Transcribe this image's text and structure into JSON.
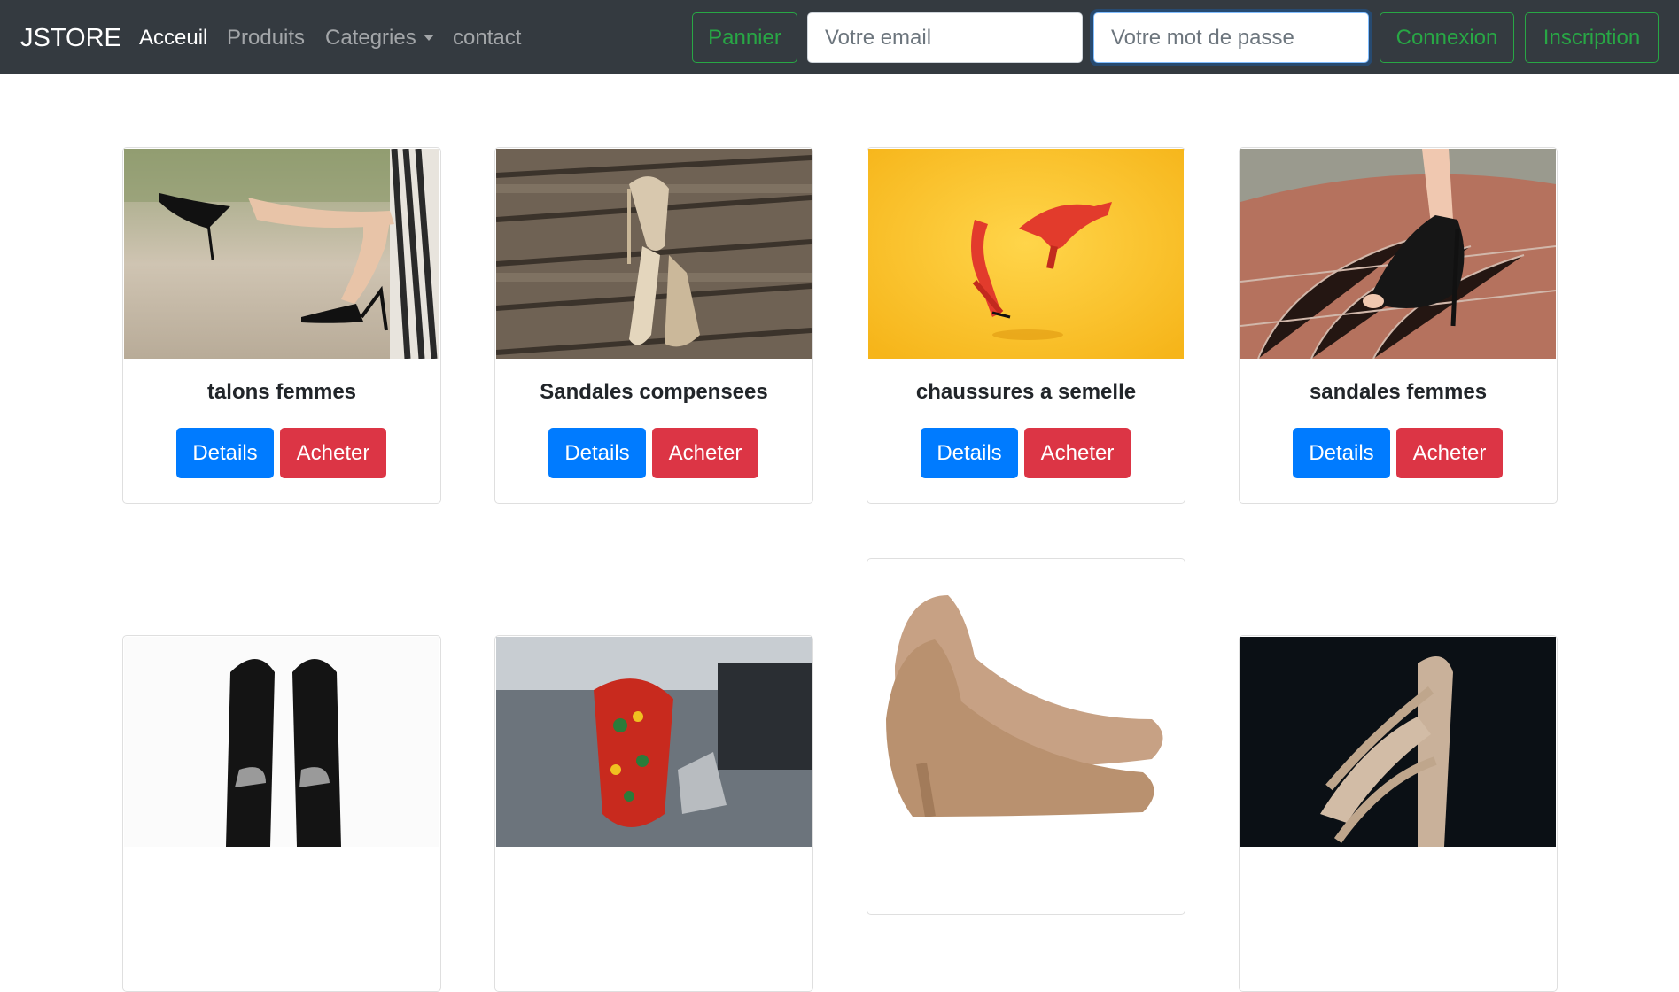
{
  "navbar": {
    "brand": "JSTORE",
    "links": [
      "Acceuil",
      "Produits",
      "Categries",
      "contact"
    ],
    "cart_label": "Pannier",
    "email_placeholder": "Votre email",
    "password_placeholder": "Votre mot de passe",
    "login_label": "Connexion",
    "signup_label": "Inscription"
  },
  "products": [
    {
      "name": "talons femmes",
      "details_label": "Details",
      "buy_label": "Acheter"
    },
    {
      "name": "Sandales compensees",
      "details_label": "Details",
      "buy_label": "Acheter"
    },
    {
      "name": "chaussures a semelle",
      "details_label": "Details",
      "buy_label": "Acheter"
    },
    {
      "name": "sandales femmes",
      "details_label": "Details",
      "buy_label": "Acheter"
    },
    {
      "name": "",
      "details_label": "",
      "buy_label": ""
    },
    {
      "name": "",
      "details_label": "",
      "buy_label": ""
    },
    {
      "name": "",
      "details_label": "",
      "buy_label": ""
    },
    {
      "name": "",
      "details_label": "",
      "buy_label": ""
    }
  ],
  "colors": {
    "navbar_bg": "#343a40",
    "success": "#28a745",
    "primary": "#007bff",
    "danger": "#dc3545"
  }
}
